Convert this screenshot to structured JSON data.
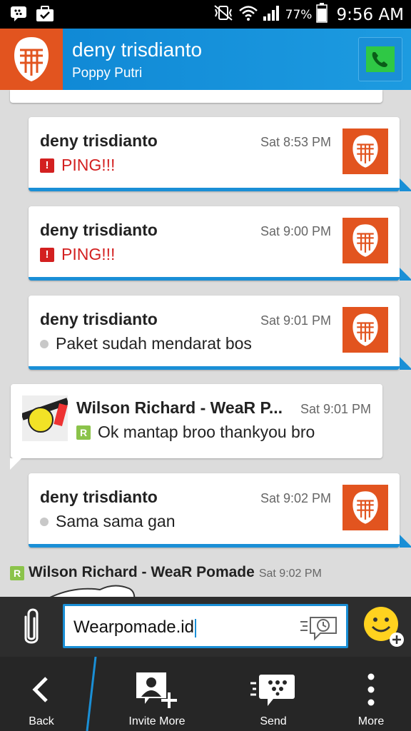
{
  "status_bar": {
    "battery": "77%",
    "time": "9:56 AM",
    "icons": [
      "bbm-icon",
      "briefcase-icon",
      "vibrate-icon",
      "wifi-icon",
      "signal-icon",
      "battery-icon"
    ]
  },
  "header": {
    "name": "deny trisdianto",
    "subtitle": "Poppy Putri"
  },
  "messages": [
    {
      "sender": "deny trisdianto",
      "time": "Sat 8:53 PM",
      "text": "PING!!!",
      "kind": "ping",
      "direction": "out"
    },
    {
      "sender": "deny trisdianto",
      "time": "Sat 9:00 PM",
      "text": "PING!!!",
      "kind": "ping",
      "direction": "out"
    },
    {
      "sender": "deny trisdianto",
      "time": "Sat 9:01 PM",
      "text": "Paket sudah mendarat bos",
      "kind": "delivered",
      "direction": "out"
    },
    {
      "sender": "Wilson Richard - WeaR P...",
      "time": "Sat 9:01 PM",
      "text": "Ok mantap broo thankyou bro",
      "kind": "read",
      "direction": "in"
    },
    {
      "sender": "deny trisdianto",
      "time": "Sat 9:02 PM",
      "text": "Sama sama gan",
      "kind": "delivered",
      "direction": "out"
    }
  ],
  "footer_message": {
    "sender": "Wilson Richard - WeaR Pomade",
    "time": "Sat 9:02 PM"
  },
  "input": {
    "value": "Wearpomade.id"
  },
  "actions": {
    "back": "Back",
    "invite_more": "Invite More",
    "send": "Send",
    "more": "More"
  },
  "colors": {
    "accent_blue": "#1a8fd6",
    "avatar_orange": "#e2541f",
    "ping_red": "#d32020",
    "read_green": "#8bc34a"
  }
}
